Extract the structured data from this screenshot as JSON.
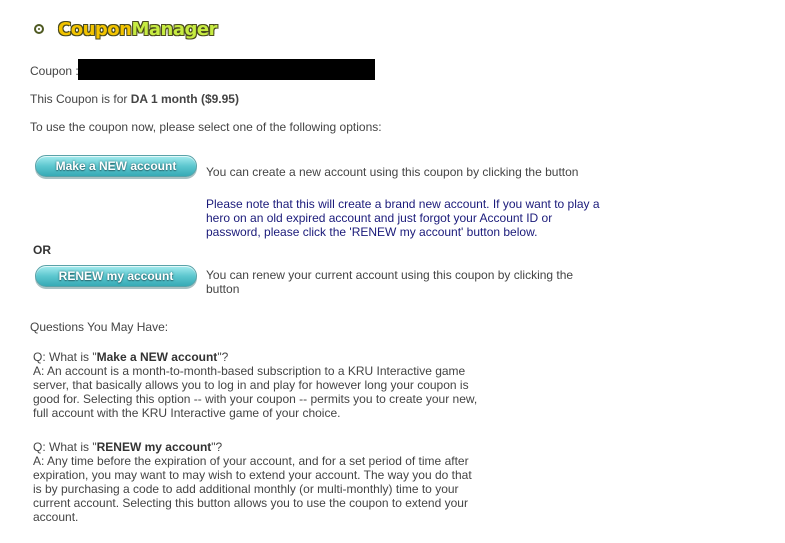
{
  "header": {
    "title_part1": "Coupon",
    "title_part2": "Manager"
  },
  "coupon": {
    "label": "Coupon :",
    "summary_prefix": "This Coupon is for",
    "summary_value": "DA 1 month ($9.95)"
  },
  "instructions": "To use the coupon now, please select one of the following options:",
  "options": {
    "new_button": "Make a NEW account",
    "new_desc": "You can create a new account using this coupon by clicking the button",
    "new_note": "Please note that this will create a brand new account. If you want to play a hero on an old expired account and just forgot your Account ID or password, please click the 'RENEW my account' button below.",
    "or": "OR",
    "renew_button": "RENEW my account",
    "renew_desc": "You can renew your current account using this coupon by clicking the button"
  },
  "faq": {
    "heading": "Questions You May Have:",
    "q1_prefix": "Q: What is \"",
    "q1_term": "Make a NEW account",
    "q1_suffix": "\"?",
    "a1": "A: An account is a month-to-month-based subscription to a KRU Interactive game server, that basically allows you to log in and play for however long your coupon is good for. Selecting this option -- with your coupon -- permits you to create your new, full account with the KRU Interactive game of your choice.",
    "q2_prefix": "Q: What is \"",
    "q2_term": "RENEW my account",
    "q2_suffix": "\"?",
    "a2": "A: Any time before the expiration of your account, and for a set period of time after expiration, you may want to may wish to extend your account. The way you do that is by purchasing a code to add additional monthly (or multi-monthly) time to your current account. Selecting this button allows you to use the coupon to extend your account."
  },
  "colors": {
    "accent_button": "#5dc7cf",
    "note_text": "#1a1a7a",
    "title_yellow": "#f3c400",
    "title_green": "#c7ec42"
  }
}
